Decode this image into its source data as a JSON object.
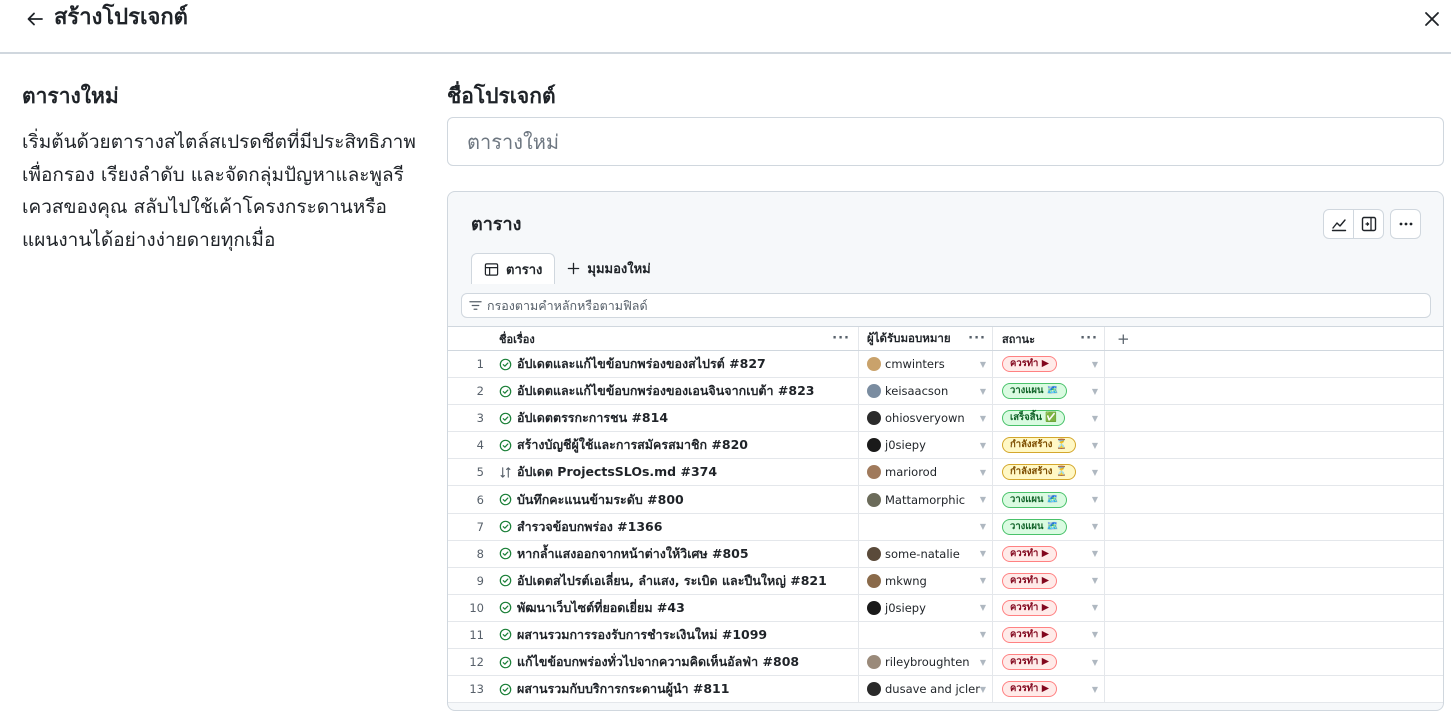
{
  "dialog": {
    "title": "สร้างโปรเจกต์"
  },
  "template": {
    "title": "ตารางใหม่",
    "description": "เริ่มต้นด้วยตารางสไตล์สเปรดชีตที่มีประสิทธิภาพเพื่อกรอง เรียงลำดับ และจัดกลุ่มปัญหาและพูลรีเควสของคุณ สลับไปใช้เค้าโครงกระดานหรือแผนงานได้อย่างง่ายดายทุกเมื่อ"
  },
  "project_name": {
    "label": "ชื่อโปรเจกต์",
    "placeholder": "ตารางใหม่",
    "value": ""
  },
  "preview": {
    "title": "ตาราง",
    "tabs": [
      {
        "label": "ตาราง",
        "icon": "table-icon"
      },
      {
        "label": "มุมมองใหม่",
        "icon": "plus-icon"
      }
    ],
    "filter_placeholder": "กรองตามคำหลักหรือตามฟิลด์",
    "columns": {
      "title": "ชื่อเรื่อง",
      "assignees": "ผู้ได้รับมอบหมาย",
      "status": "สถานะ",
      "more": "···",
      "add": "+"
    },
    "rows": [
      {
        "num": "1",
        "title": "อัปเดตและแก้ไขข้อบกพร่องของสไปรต์ #827",
        "icon": "issue-open-icon",
        "assignee": "cmwinters",
        "avatar": "#c9a26b",
        "status": "ควรทำ ▶",
        "tone": "red"
      },
      {
        "num": "2",
        "title": "อัปเดตและแก้ไขข้อบกพร่องของเอนจินจากเบต้า #823",
        "icon": "issue-open-icon",
        "assignee": "keisaacson",
        "avatar": "#7a8ca0",
        "status": "วางแผน 🗺️",
        "tone": "green"
      },
      {
        "num": "3",
        "title": "อัปเดตตรรกะการชน #814",
        "icon": "issue-open-icon",
        "assignee": "ohiosveryown",
        "avatar": "#2b2b2b",
        "status": "เสร็จสิ้น ✅",
        "tone": "green"
      },
      {
        "num": "4",
        "title": "สร้างบัญชีผู้ใช้และการสมัครสมาชิก #820",
        "icon": "issue-open-icon",
        "assignee": "j0siepy",
        "avatar": "#1a1a1a",
        "status": "กำลังสร้าง ⏳",
        "tone": "yellow"
      },
      {
        "num": "5",
        "title": "อัปเดต ProjectsSLOs.md #374",
        "icon": "pull-request-icon",
        "assignee": "mariorod",
        "avatar": "#a07a5c",
        "status": "กำลังสร้าง ⏳",
        "tone": "yellow"
      },
      {
        "num": "6",
        "title": "บันทึกคะแนนข้ามระดับ #800",
        "icon": "issue-open-icon",
        "assignee": "Mattamorphic",
        "avatar": "#6b6b5a",
        "status": "วางแผน 🗺️",
        "tone": "green"
      },
      {
        "num": "7",
        "title": "สำรวจข้อบกพร่อง #1366",
        "icon": "issue-open-icon",
        "assignee": "",
        "avatar": "",
        "status": "วางแผน 🗺️",
        "tone": "green"
      },
      {
        "num": "8",
        "title": "หากล้ำแสงออกจากหน้าต่างให้วิเศษ #805",
        "icon": "issue-open-icon",
        "assignee": "some-natalie",
        "avatar": "#5a4a3a",
        "status": "ควรทำ ▶",
        "tone": "red"
      },
      {
        "num": "9",
        "title": "อัปเดตสไปรต์เอเลี่ยน, ลำแสง, ระเบิด และปืนใหญ่ #821",
        "icon": "issue-open-icon",
        "assignee": "mkwng",
        "avatar": "#8a6a4a",
        "status": "ควรทำ ▶",
        "tone": "red"
      },
      {
        "num": "10",
        "title": "พัฒนาเว็บไซต์ที่ยอดเยี่ยม #43",
        "icon": "issue-open-icon",
        "assignee": "j0siepy",
        "avatar": "#1a1a1a",
        "status": "ควรทำ ▶",
        "tone": "red"
      },
      {
        "num": "11",
        "title": "ผสานรวมการรองรับการชำระเงินใหม่ #1099",
        "icon": "issue-open-icon",
        "assignee": "",
        "avatar": "",
        "status": "ควรทำ ▶",
        "tone": "red"
      },
      {
        "num": "12",
        "title": "แก้ไขข้อบกพร่องทั่วไปจากความคิดเห็นอัลฟ่า #808",
        "icon": "issue-open-icon",
        "assignee": "rileybroughten",
        "avatar": "#9a8a7a",
        "status": "ควรทำ ▶",
        "tone": "red"
      },
      {
        "num": "13",
        "title": "ผสานรวมกับบริการกระดานผู้นำ #811",
        "icon": "issue-open-icon",
        "assignee": "dusave and jclem",
        "avatar": "#2a2a2a",
        "status": "ควรทำ ▶",
        "tone": "red"
      }
    ]
  }
}
